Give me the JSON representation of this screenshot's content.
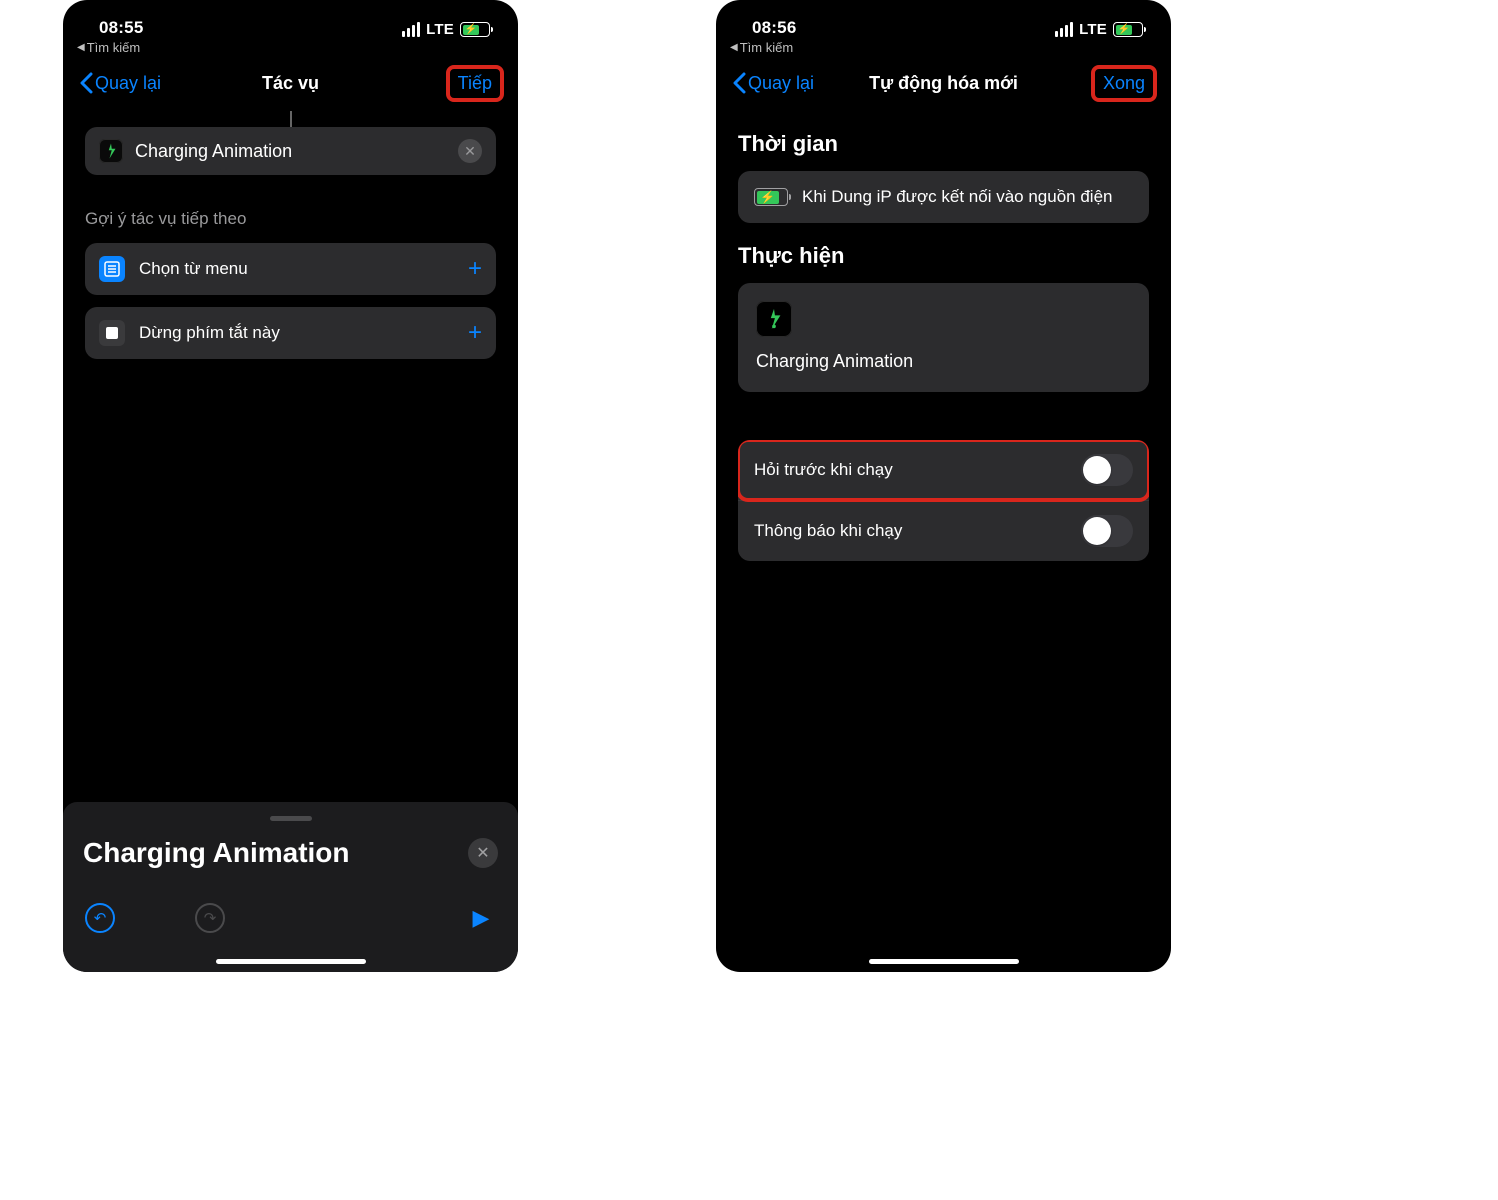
{
  "left": {
    "status": {
      "time": "08:55",
      "lte": "LTE",
      "backapp": "Tìm kiếm"
    },
    "nav": {
      "back": "Quay lại",
      "title": "Tác vụ",
      "action": "Tiếp"
    },
    "action_card": {
      "label": "Charging Animation"
    },
    "suggest_title": "Gợi ý tác vụ tiếp theo",
    "suggest": [
      {
        "label": "Chọn từ menu"
      },
      {
        "label": "Dừng phím tắt này"
      }
    ],
    "sheet": {
      "title": "Charging Animation"
    }
  },
  "right": {
    "status": {
      "time": "08:56",
      "lte": "LTE",
      "backapp": "Tìm kiếm"
    },
    "nav": {
      "back": "Quay lại",
      "title": "Tự động hóa mới",
      "action": "Xong"
    },
    "when_head": "Thời gian",
    "when_text": "Khi Dung iP được kết nối vào nguồn điện",
    "do_head": "Thực hiện",
    "do_label": "Charging Animation",
    "opts": {
      "ask": "Hỏi trước khi chạy",
      "notify": "Thông báo khi chạy"
    }
  }
}
